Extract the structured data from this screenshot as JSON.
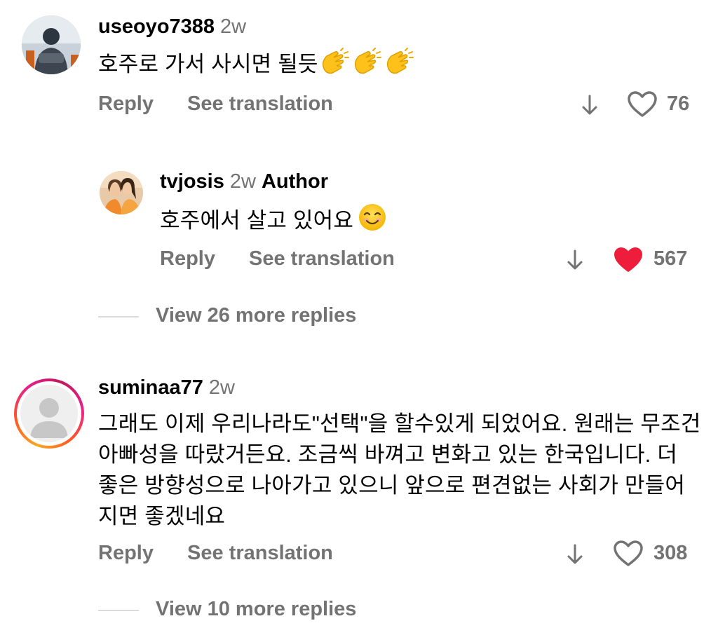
{
  "comments": [
    {
      "username": "useoyo7388",
      "time": "2w",
      "text": "호주로 가서 사시면 될듯",
      "emojis": [
        "clapping-hands-emoji",
        "clapping-hands-emoji",
        "clapping-hands-emoji"
      ],
      "reply_label": "Reply",
      "translate_label": "See translation",
      "likes": "76",
      "liked": false
    },
    {
      "username": "suminaa77",
      "time": "2w",
      "text": "그래도 이제 우리나라도\"선택\"을 할수있게 되었어요. 원래는 무조건 아빠성을 따랐거든요. 조금씩 바껴고 변화고 있는 한국입니다. 더 좋은 방향성으로 나아가고 있으니 앞으로 편견없는 사회가 만들어지면 좋겠네요",
      "reply_label": "Reply",
      "translate_label": "See translation",
      "likes": "308",
      "liked": false,
      "view_replies": "View 10 more replies"
    }
  ],
  "reply": {
    "username": "tvjosis",
    "time": "2w",
    "badge": "Author",
    "text": "호주에서 살고 있어요",
    "emoji": "smiling-face-emoji",
    "reply_label": "Reply",
    "translate_label": "See translation",
    "likes": "567",
    "liked": true,
    "view_replies": "View 26 more replies"
  },
  "colors": {
    "text": "#000000",
    "secondary": "#737373",
    "liked_heart": "#ed1d3b",
    "story_ring_start": "#f9a825",
    "story_ring_end": "#e91e8c"
  }
}
